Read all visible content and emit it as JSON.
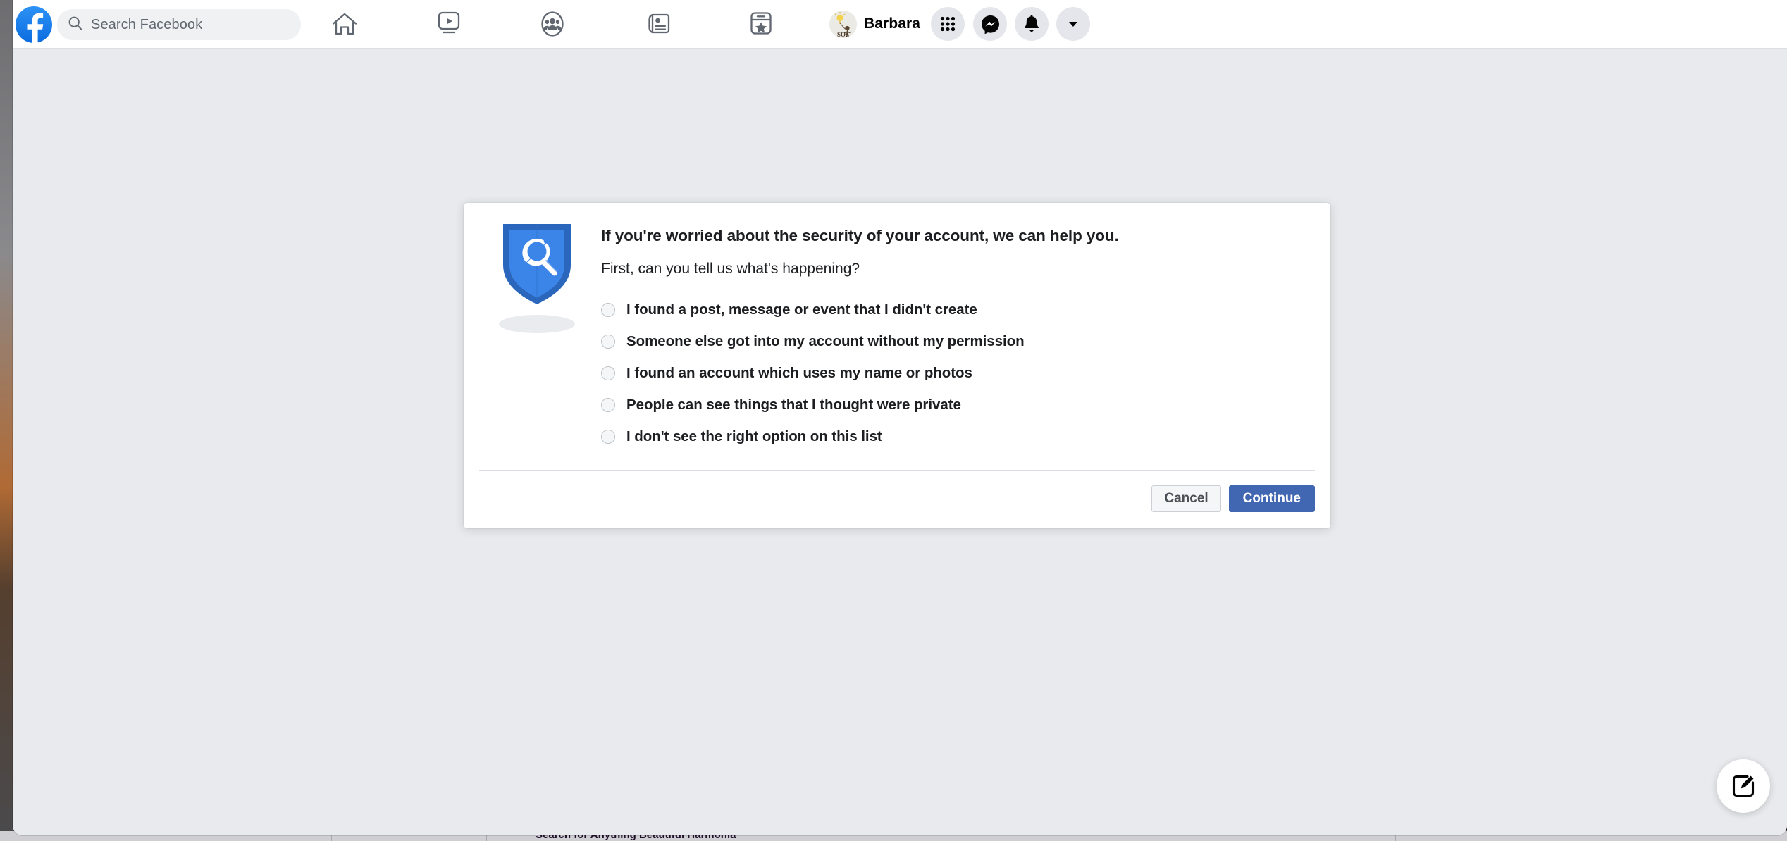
{
  "window": {
    "background_color": "#e8eaed"
  },
  "header": {
    "logo_icon": "facebook-logo-icon",
    "search": {
      "icon": "search-icon",
      "placeholder": "Search Facebook"
    },
    "nav": [
      {
        "id": "home",
        "icon": "home-icon"
      },
      {
        "id": "watch",
        "icon": "video-play-icon"
      },
      {
        "id": "groups",
        "icon": "groups-icon"
      },
      {
        "id": "news",
        "icon": "newspaper-icon"
      },
      {
        "id": "gaming",
        "icon": "gaming-star-icon"
      }
    ],
    "profile": {
      "name": "Barbara",
      "avatar_icon": "avatar-lightbulb-sos"
    },
    "actions": [
      {
        "id": "menu",
        "icon": "grid-menu-icon"
      },
      {
        "id": "messenger",
        "icon": "messenger-icon"
      },
      {
        "id": "notifications",
        "icon": "bell-icon"
      },
      {
        "id": "account",
        "icon": "chevron-down-icon"
      }
    ]
  },
  "dialog": {
    "illustration_icon": "shield-wrench-icon",
    "title": "If you're worried about the security of your account, we can help you.",
    "subtitle": "First, can you tell us what's happening?",
    "options": [
      {
        "id": "opt-1",
        "label": "I found a post, message or event that I didn't create",
        "selected": false
      },
      {
        "id": "opt-2",
        "label": "Someone else got into my account without my permission",
        "selected": false
      },
      {
        "id": "opt-3",
        "label": "I found an account which uses my name or photos",
        "selected": false
      },
      {
        "id": "opt-4",
        "label": "People can see things that I thought were private",
        "selected": false
      },
      {
        "id": "opt-5",
        "label": "I don't see the right option on this list",
        "selected": false
      }
    ],
    "cancel_label": "Cancel",
    "continue_label": "Continue",
    "continue_color": "#4267b2"
  },
  "floating": {
    "compose_icon": "compose-edit-icon"
  },
  "taskbar": {
    "text": "Search for Anything Beautiful Harmonia"
  }
}
